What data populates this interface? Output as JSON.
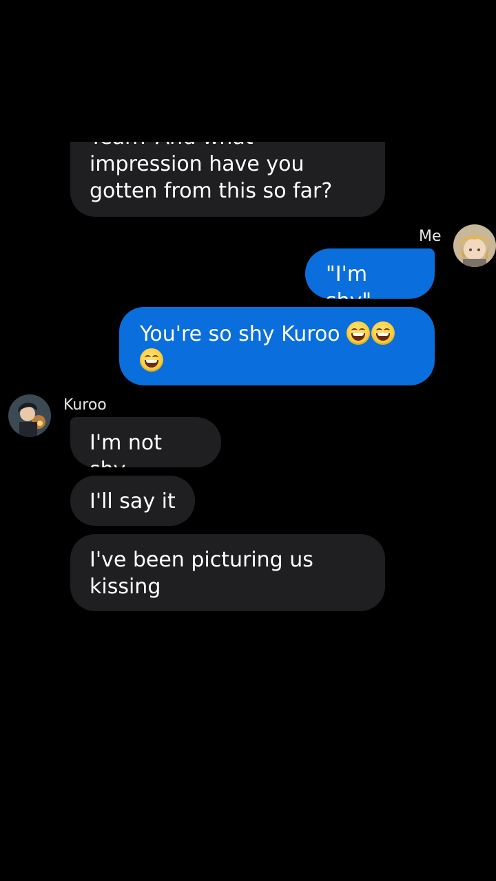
{
  "conversation": {
    "contact_name": "Kuroo",
    "self_name": "Me",
    "messages": [
      {
        "from": "Kuroo",
        "text": "Yeah? And what impression have you gotten from this so far?"
      },
      {
        "from": "Me",
        "text": "\"I'm shy\""
      },
      {
        "from": "Me",
        "text": "You're so shy Kuroo",
        "emoji": [
          "grinning-squinting-face",
          "grinning-squinting-face",
          "grinning-squinting-face"
        ]
      },
      {
        "from": "Kuroo",
        "text": "I'm not shy"
      },
      {
        "from": "Kuroo",
        "text": "I'll say it"
      },
      {
        "from": "Kuroo",
        "text": "I've been picturing us kissing"
      }
    ]
  },
  "colors": {
    "background": "#000000",
    "incoming_bubble": "#1f1f21",
    "outgoing_bubble": "#0a6fdc",
    "text": "#ffffff"
  },
  "icons": {
    "self_avatar": "avatar-blonde-character",
    "contact_avatar": "avatar-dark-hair-character",
    "emoji": "grinning-squinting-face"
  }
}
